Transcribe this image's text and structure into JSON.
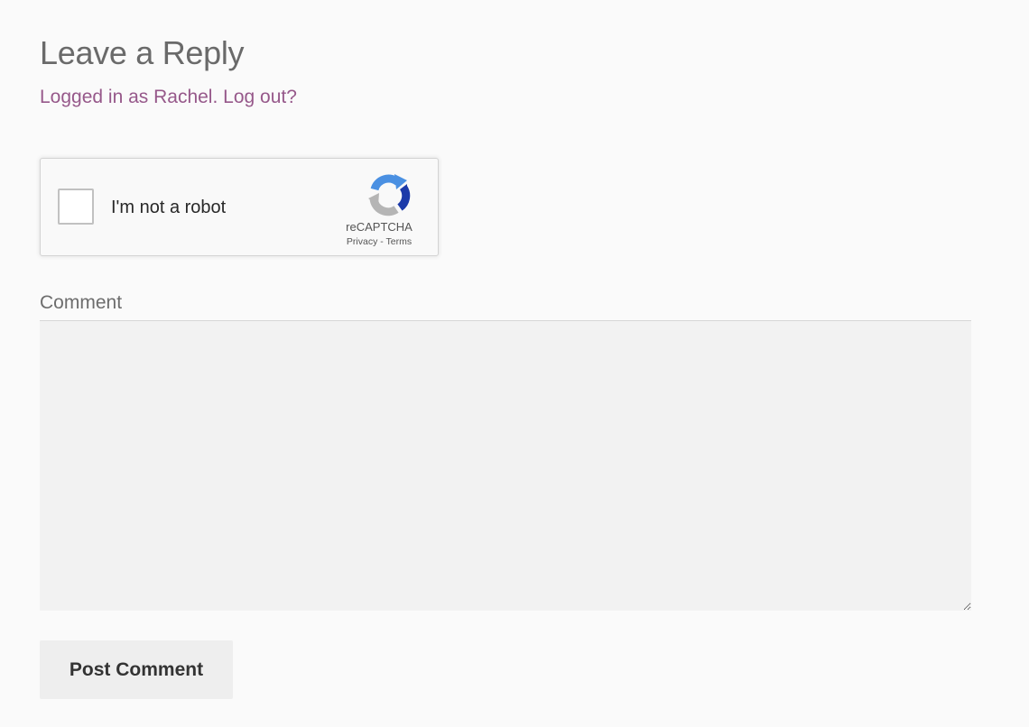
{
  "reply": {
    "title": "Leave a Reply",
    "logged_in_text": "Logged in as Rachel. ",
    "logout_link": "Log out?"
  },
  "recaptcha": {
    "checkbox_label": "I'm not a robot",
    "brand": "reCAPTCHA",
    "privacy_link": "Privacy",
    "separator": " - ",
    "terms_link": "Terms",
    "icon": "recaptcha-logo-icon"
  },
  "comment": {
    "label": "Comment",
    "value": ""
  },
  "submit": {
    "label": "Post Comment"
  },
  "colors": {
    "link": "#96588a",
    "page_background": "#fafafa",
    "textarea_background": "#f2f2f2",
    "button_background": "#eeeeee"
  }
}
